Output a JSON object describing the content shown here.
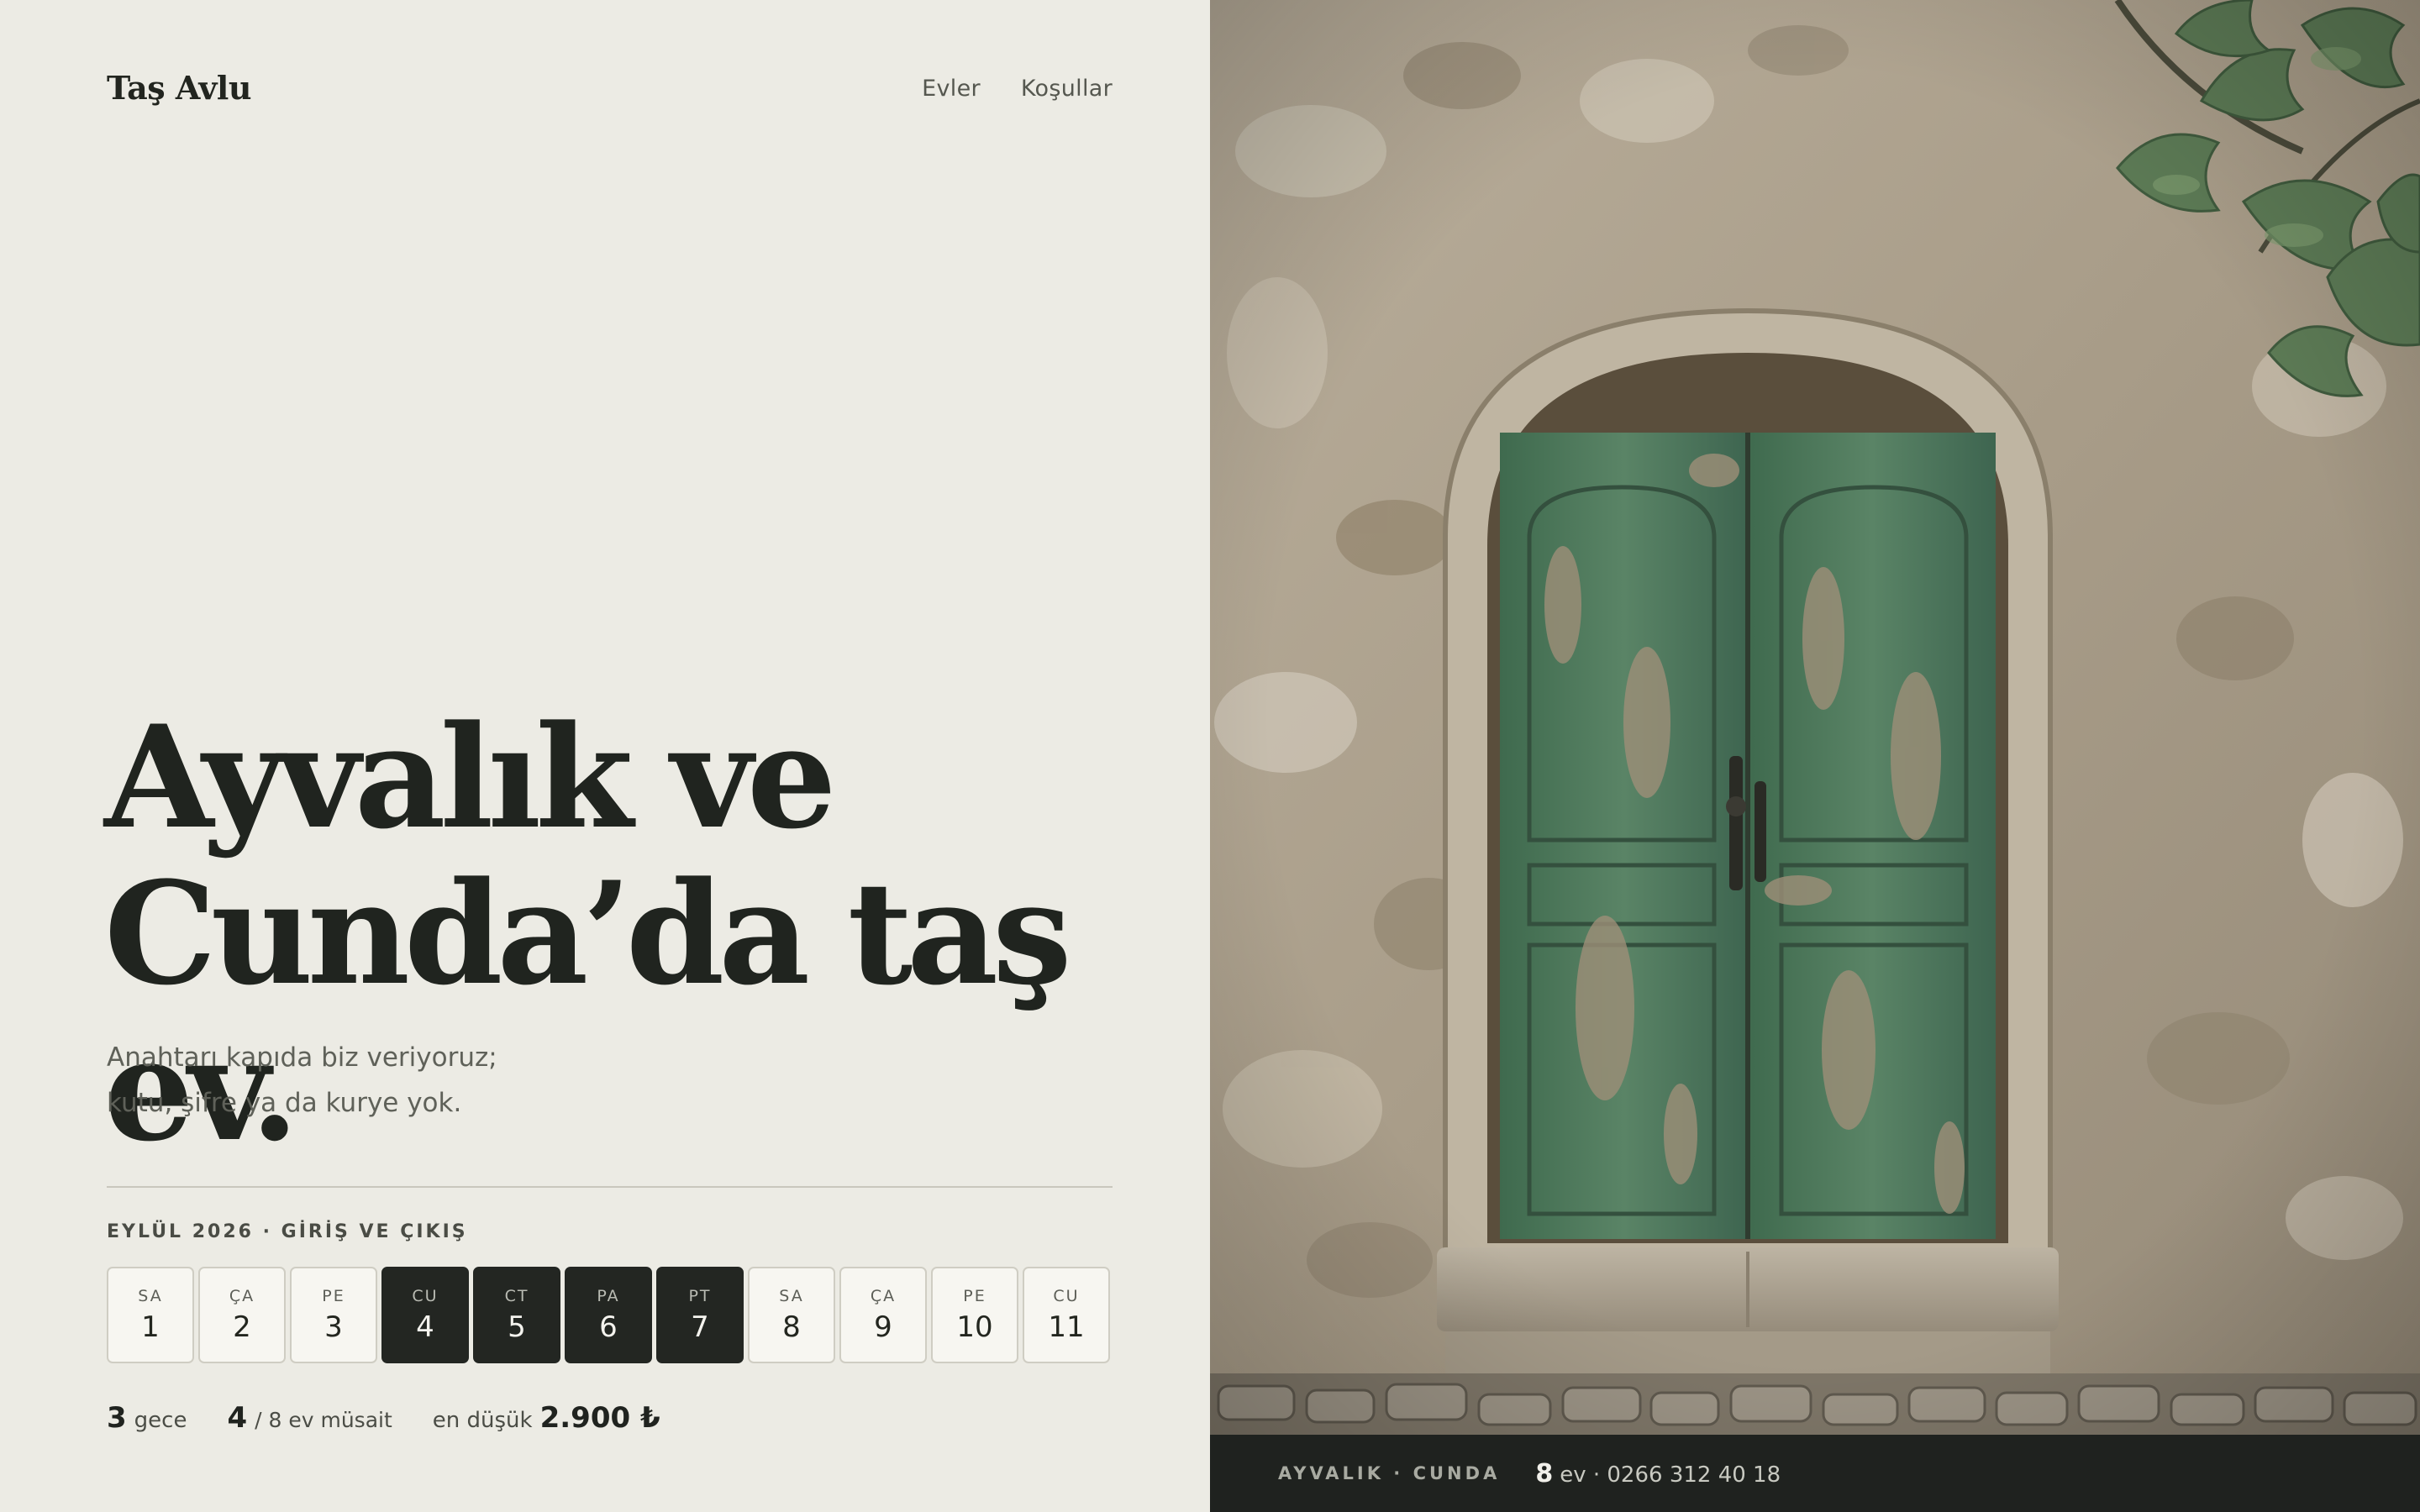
{
  "brand": "Taş Avlu",
  "nav": {
    "homes": "Evler",
    "terms": "Koşullar"
  },
  "hero": {
    "title_line1": "Ayvalık ve",
    "title_line2": "Cunda’da taş ev.",
    "subtitle_line1": "Anahtarı kapıda biz veriyoruz;",
    "subtitle_line2": "kutu, şifre ya da kurye yok."
  },
  "dates": {
    "heading": "EYLÜL 2026 · GİRİŞ VE ÇIKIŞ",
    "days": [
      {
        "dow": "SA",
        "num": "1",
        "selected": false
      },
      {
        "dow": "ÇA",
        "num": "2",
        "selected": false
      },
      {
        "dow": "PE",
        "num": "3",
        "selected": false
      },
      {
        "dow": "CU",
        "num": "4",
        "selected": true
      },
      {
        "dow": "CT",
        "num": "5",
        "selected": true
      },
      {
        "dow": "PA",
        "num": "6",
        "selected": true
      },
      {
        "dow": "PT",
        "num": "7",
        "selected": true
      },
      {
        "dow": "SA",
        "num": "8",
        "selected": false
      },
      {
        "dow": "ÇA",
        "num": "9",
        "selected": false
      },
      {
        "dow": "PE",
        "num": "10",
        "selected": false
      },
      {
        "dow": "CU",
        "num": "11",
        "selected": false
      }
    ]
  },
  "stats": {
    "nights_value": "3",
    "nights_label": "gece",
    "available_value": "4",
    "available_label": "/ 8 ev müsait",
    "price_label": "en düşük",
    "price_value": "2.900 ₺"
  },
  "footer": {
    "location": "AYVALIK · CUNDA",
    "home_count": "8",
    "info": "ev · 0266 312 40 18"
  },
  "colors": {
    "background": "#ecebe4",
    "ink": "#20241f",
    "selected_day": "#232622",
    "footer_bar": "#1f221f",
    "door_green": "#4f7a5c"
  }
}
